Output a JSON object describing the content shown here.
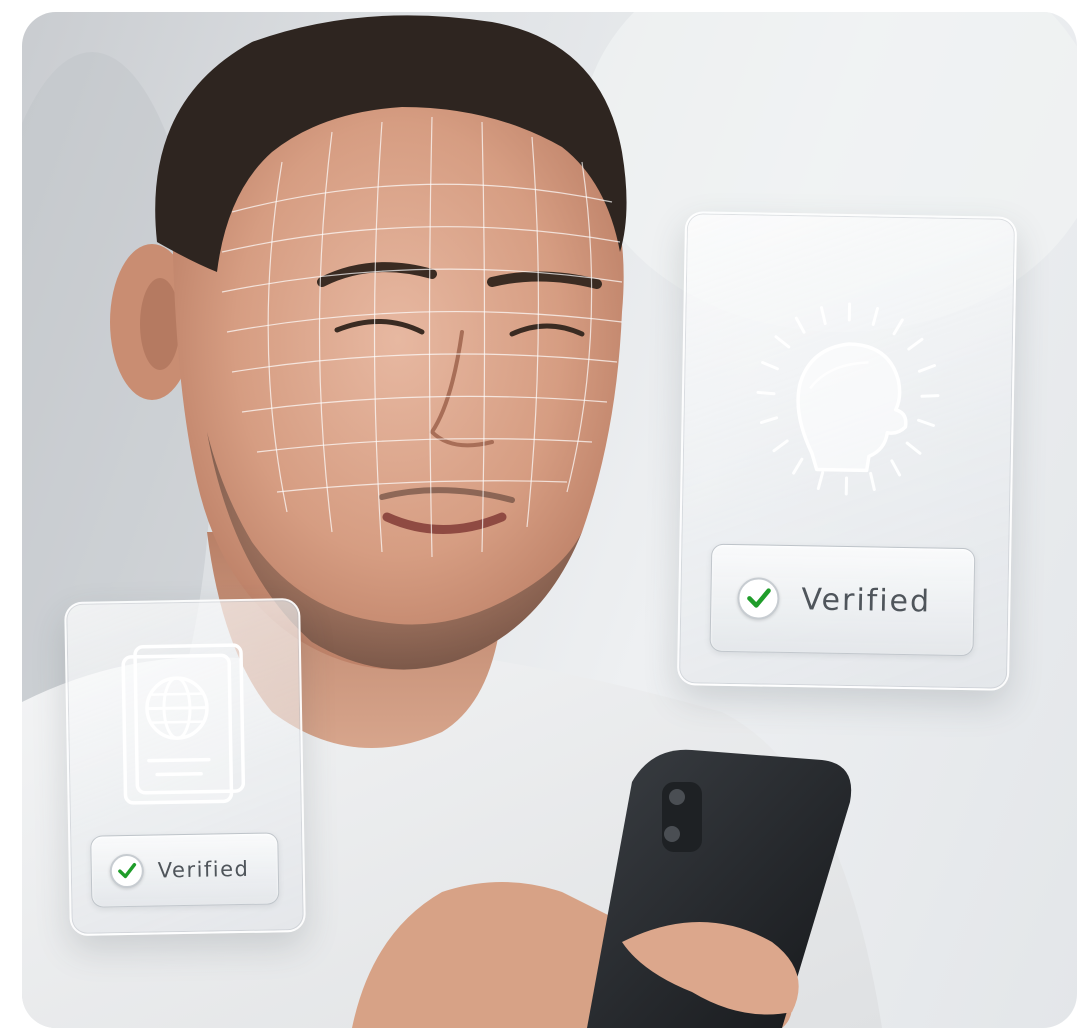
{
  "scene": {
    "subject_name": "person-with-face-scan-mesh",
    "device_name": "smartphone"
  },
  "face_card": {
    "icon": "face-scan-icon",
    "check_icon": "green-check-icon",
    "label": "Verified",
    "check_color": "#1f9d2a"
  },
  "passport_card": {
    "icon": "passport-icon",
    "check_icon": "green-check-icon",
    "label": "Verified",
    "check_color": "#1f9d2a"
  }
}
